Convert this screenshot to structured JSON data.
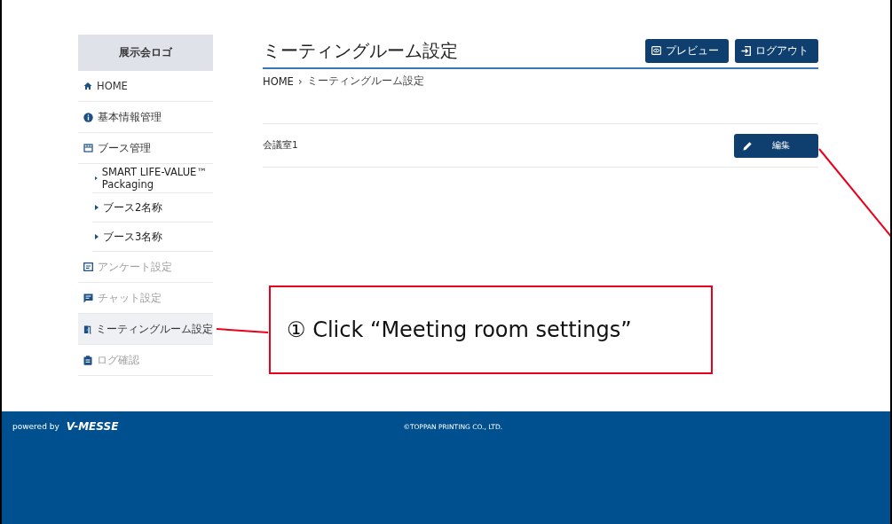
{
  "sidebar": {
    "logo": "展示会ロゴ",
    "items": [
      {
        "label": "HOME",
        "selected": false,
        "disabled": false
      },
      {
        "label": "基本情報管理",
        "selected": false,
        "disabled": false
      },
      {
        "label": "ブース管理",
        "selected": false,
        "disabled": false,
        "children": [
          {
            "label": "SMART LIFE-VALUE™ Packaging"
          },
          {
            "label": "ブース2名称"
          },
          {
            "label": "ブース3名称"
          }
        ]
      },
      {
        "label": "アンケート設定",
        "selected": false,
        "disabled": true
      },
      {
        "label": "チャット設定",
        "selected": false,
        "disabled": true
      },
      {
        "label": "ミーティングルーム設定",
        "selected": true,
        "disabled": false
      },
      {
        "label": "ログ確認",
        "selected": false,
        "disabled": true
      }
    ]
  },
  "header": {
    "title": "ミーティングルーム設定",
    "buttons": [
      "プレビュー",
      "ログアウト"
    ]
  },
  "breadcrumb": {
    "separator": "›",
    "items": [
      "HOME",
      "ミーティングルーム設定"
    ]
  },
  "rooms": [
    {
      "name": "会議室1",
      "button": "編集"
    }
  ],
  "callout": {
    "text": "① Click “Meeting room settings”"
  },
  "footer": {
    "powered_by": "powered by",
    "brand": "V-MESSE",
    "copyright": "©TOPPAN PRINTING CO., LTD."
  }
}
